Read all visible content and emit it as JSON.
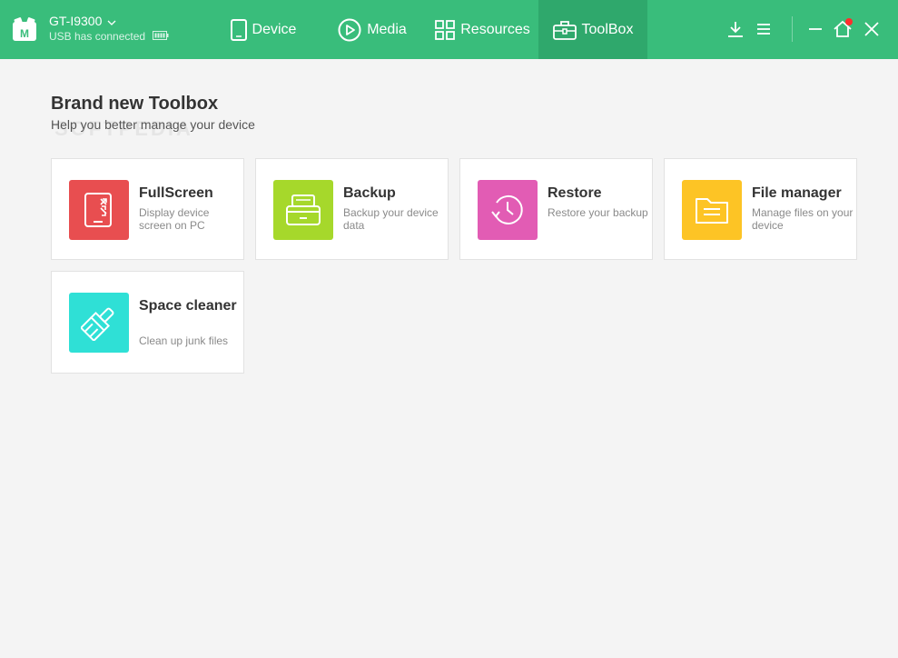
{
  "app": {
    "device_name": "GT-I9300",
    "device_status": "USB has connected"
  },
  "nav": [
    {
      "label": "Device",
      "icon": "phone-icon"
    },
    {
      "label": "Media",
      "icon": "play-icon"
    },
    {
      "label": "Resources",
      "icon": "grid-icon"
    },
    {
      "label": "ToolBox",
      "icon": "toolbox-icon",
      "active": true
    }
  ],
  "page": {
    "title": "Brand new Toolbox",
    "subtitle": "Help you better manage your device",
    "watermark": "SOFTPEDIA"
  },
  "tools": [
    {
      "title": "FullScreen",
      "desc": "Display device screen on PC",
      "color": "#e84e50",
      "icon": "fullscreen-icon"
    },
    {
      "title": "Backup",
      "desc": "Backup your device data",
      "color": "#a6d82b",
      "icon": "backup-icon"
    },
    {
      "title": "Restore",
      "desc": "Restore your backup",
      "color": "#e25cb4",
      "icon": "restore-icon"
    },
    {
      "title": "File manager",
      "desc": "Manage files on your device",
      "color": "#fdc425",
      "icon": "folder-icon"
    },
    {
      "title": "Space cleaner",
      "desc": "Clean up junk files",
      "color": "#2fe0d6",
      "icon": "brush-icon"
    }
  ],
  "colors": {
    "topbar": "#39bd7b",
    "topbar_active": "#2fa86c",
    "notification_dot": "#ff2d2d"
  }
}
